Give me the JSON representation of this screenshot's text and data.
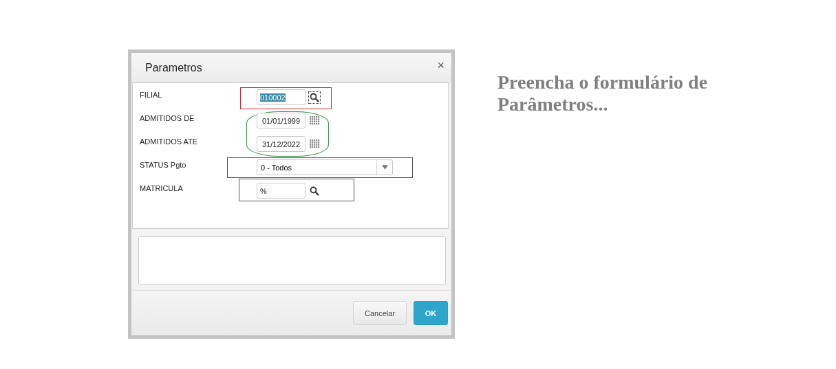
{
  "dialog": {
    "title": "Parametros",
    "close": "×",
    "groups": [
      {
        "highlight": {
          "kind": "rect",
          "color": "#cc2a2a"
        },
        "rows": [
          {
            "label": "FILIAL",
            "kind": "lookup",
            "value": "010002",
            "value_selected": true,
            "button_focused": true
          }
        ]
      },
      {
        "highlight": {
          "kind": "ellipse",
          "color": "#3a9a4a"
        },
        "rows": [
          {
            "label": "ADMITIDOS DE",
            "kind": "date",
            "value": "01/01/1999"
          },
          {
            "label": "ADMITIDOS ATE",
            "kind": "date",
            "value": "31/12/2022"
          }
        ]
      },
      {
        "highlight": {
          "kind": "rect",
          "color": "#555555"
        },
        "rows": [
          {
            "label": "STATUS Pgto",
            "kind": "select",
            "value": "0 - Todos"
          }
        ]
      },
      {
        "highlight": {
          "kind": "rect",
          "color": "#555555"
        },
        "rows": [
          {
            "label": "MATRICULA",
            "kind": "lookup",
            "value": "%",
            "value_selected": false,
            "button_focused": false
          }
        ]
      }
    ],
    "buttons": [
      {
        "label": "Cancelar",
        "kind": "secondary"
      },
      {
        "label": "OK",
        "kind": "primary"
      }
    ]
  },
  "side_note": "Preencha o formulário de Parâmetros..."
}
